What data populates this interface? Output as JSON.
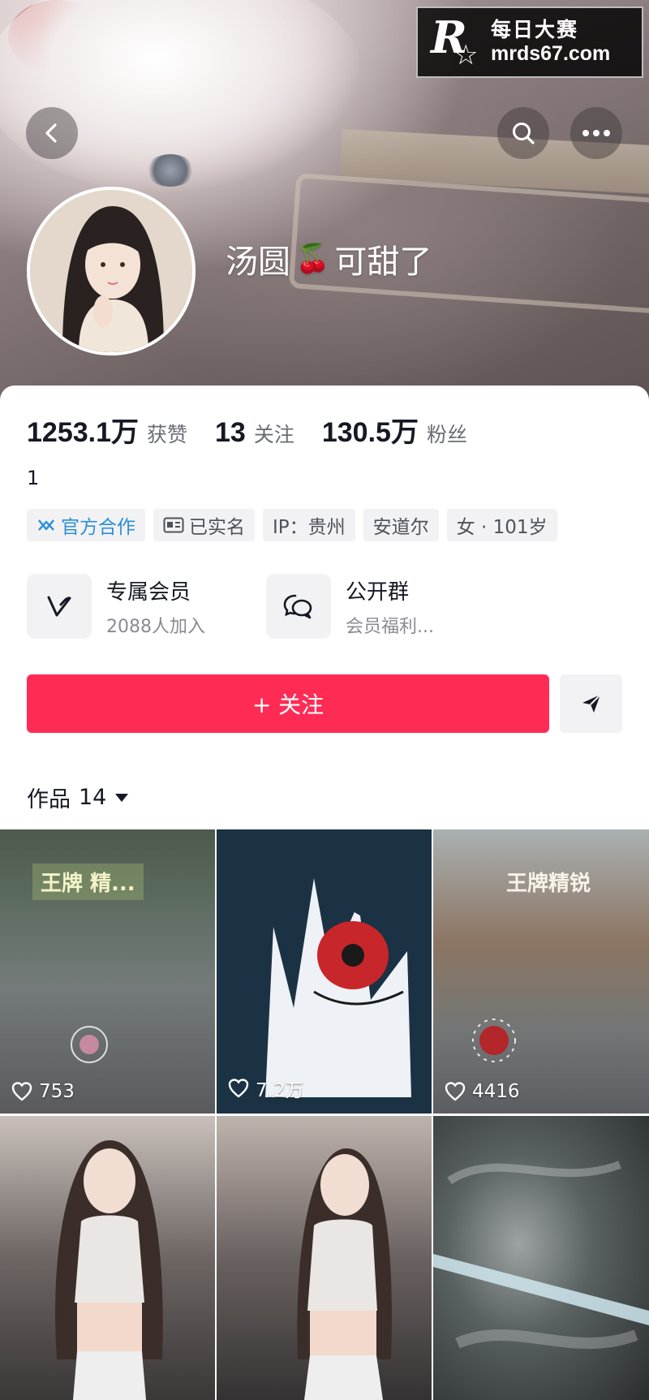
{
  "watermark": {
    "brand_cn": "每日大赛",
    "url": "mrds67.com"
  },
  "header": {
    "nickname": "汤圆",
    "nickname_suffix": "可甜了",
    "emoji": "🍒"
  },
  "stats": [
    {
      "value": "1253.1万",
      "label": "获赞"
    },
    {
      "value": "13",
      "label": "关注"
    },
    {
      "value": "130.5万",
      "label": "粉丝"
    }
  ],
  "bio": "1",
  "tags": [
    {
      "label": "官方合作",
      "icon": "official-partner-icon"
    },
    {
      "label": "已实名",
      "icon": "id-card-icon"
    },
    {
      "label": "IP：贵州"
    },
    {
      "label": "安道尔"
    },
    {
      "label": "女 · 101岁"
    }
  ],
  "features": [
    {
      "title": "专属会员",
      "subtitle": "2088人加入",
      "icon": "v-member-icon"
    },
    {
      "title": "公开群",
      "subtitle": "会员福利...",
      "icon": "chat-bubbles-icon"
    }
  ],
  "follow_label": "+ 关注",
  "works": {
    "label": "作品",
    "count": "14"
  },
  "grid": [
    {
      "likes": "753",
      "overlay": "王牌 精..."
    },
    {
      "likes": "7.2万"
    },
    {
      "likes": "4416",
      "overlay": "王牌精锐"
    },
    {
      "likes": ""
    },
    {
      "likes": ""
    },
    {
      "likes": ""
    }
  ],
  "colors": {
    "accent": "#fe2c55",
    "official_blue": "#2b8fd8"
  }
}
